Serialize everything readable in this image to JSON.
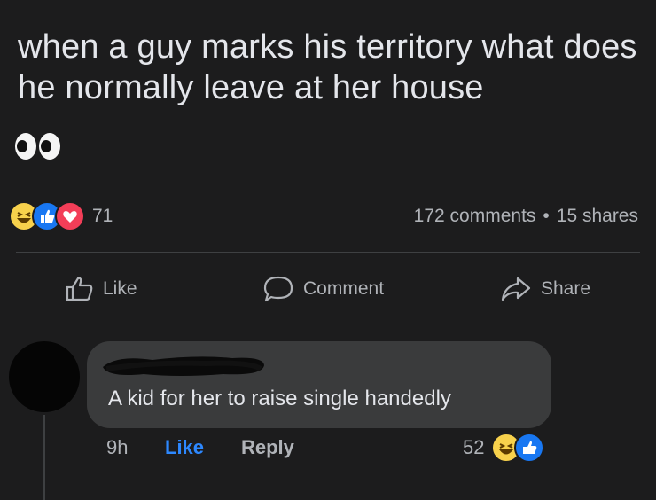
{
  "post": {
    "text": "when a guy marks his territory what does he normally leave at her house",
    "emoji": "eyes-emoji"
  },
  "reactions": {
    "icons": [
      "haha-icon",
      "like-icon",
      "love-icon"
    ],
    "count": "71",
    "comments": "172 comments",
    "separator": "•",
    "shares": "15 shares"
  },
  "actions": {
    "like": "Like",
    "comment": "Comment",
    "share": "Share"
  },
  "comment": {
    "text": "A kid for her to raise single handedly",
    "time": "9h",
    "like": "Like",
    "reply": "Reply",
    "reaction_count": "52",
    "reaction_icons": [
      "haha-icon",
      "like-icon"
    ]
  },
  "colors": {
    "background": "#1c1c1d",
    "bubble": "#3a3b3c",
    "text_primary": "#e4e6eb",
    "text_secondary": "#b0b3b8",
    "link_blue": "#2d88ff",
    "like_blue": "#1877f2",
    "love_red": "#f33e58",
    "haha_yellow": "#f7d14c"
  }
}
